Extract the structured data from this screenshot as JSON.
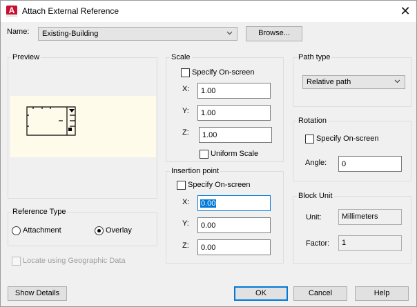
{
  "window": {
    "title": "Attach External Reference",
    "close_glyph": "✕",
    "app_icon_letter": "A"
  },
  "name": {
    "label": "Name:",
    "value": "Existing-Building",
    "browse_label": "Browse..."
  },
  "preview": {
    "title": "Preview"
  },
  "reference_type": {
    "title": "Reference Type",
    "attachment": "Attachment",
    "overlay": "Overlay",
    "selected": "overlay"
  },
  "geo": {
    "label": "Locate using Geographic Data",
    "checked": false,
    "enabled": false
  },
  "scale": {
    "title": "Scale",
    "specify_label": "Specify On-screen",
    "x_label": "X:",
    "x": "1.00",
    "y_label": "Y:",
    "y": "1.00",
    "z_label": "Z:",
    "z": "1.00",
    "uniform_label": "Uniform Scale"
  },
  "insertion": {
    "title": "Insertion point",
    "specify_label": "Specify On-screen",
    "x_label": "X:",
    "x": "0.00",
    "y_label": "Y:",
    "y": "0.00",
    "z_label": "Z:",
    "z": "0.00"
  },
  "path_type": {
    "title": "Path type",
    "value": "Relative path"
  },
  "rotation": {
    "title": "Rotation",
    "specify_label": "Specify On-screen",
    "angle_label": "Angle:",
    "angle": "0"
  },
  "block_unit": {
    "title": "Block Unit",
    "unit_label": "Unit:",
    "unit": "Millimeters",
    "factor_label": "Factor:",
    "factor": "1"
  },
  "buttons": {
    "show_details": "Show Details",
    "ok": "OK",
    "cancel": "Cancel",
    "help": "Help"
  },
  "colors": {
    "accent": "#0078d7",
    "app_icon": "#c8102e",
    "preview_bg": "#fffbea"
  }
}
